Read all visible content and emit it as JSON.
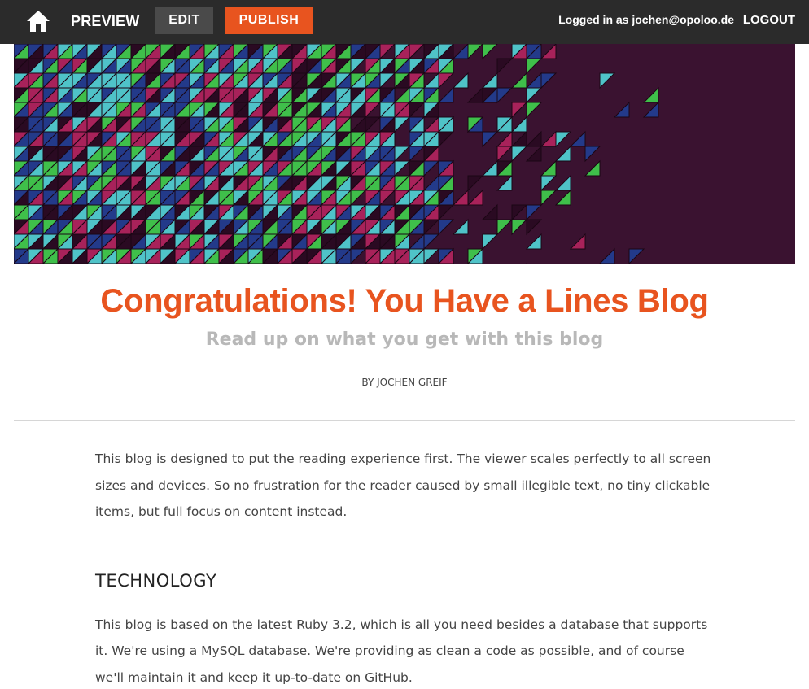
{
  "topbar": {
    "home_icon": "home-icon",
    "preview_label": "PREVIEW",
    "edit_label": "EDIT",
    "publish_label": "PUBLISH",
    "logged_in_text": "Logged in as jochen@opoloo.de",
    "logout_label": "LOGOUT"
  },
  "colors": {
    "accent": "#e8541f",
    "banner_bg": "#3a1230",
    "tile_teal": "#4fc3c8",
    "tile_green": "#3fbf4a",
    "tile_navy": "#233a8a",
    "tile_magenta": "#a8225a",
    "tile_dark": "#2a0a22"
  },
  "post": {
    "title": "Congratulations! You Have a Lines Blog",
    "subtitle": "Read up on what you get with this blog",
    "byline": "BY JOCHEN GREIF",
    "intro": "This blog is designed to put the reading experience first. The viewer scales perfectly to all screen sizes and devices. So no frustration for the reader caused by small illegible text, no tiny clickable items, but full focus on content instead.",
    "sections": [
      {
        "heading": "TECHNOLOGY",
        "body": "This blog is based on the latest Ruby 3.2, which is all you need besides a database that supports it. We're using a MySQL database. We're providing as clean a code as possible, and of course we'll maintain it and keep it up-to-date on GitHub."
      }
    ]
  }
}
